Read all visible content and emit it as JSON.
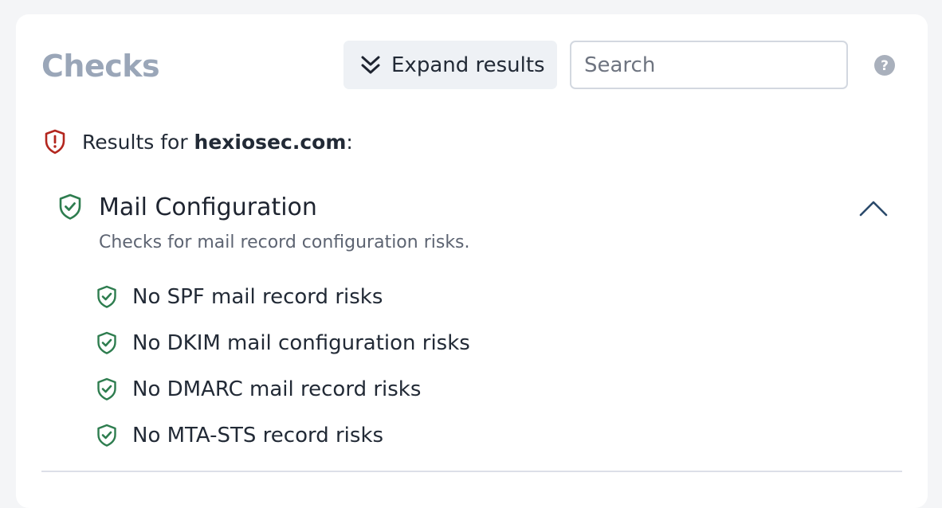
{
  "header": {
    "title": "Checks",
    "expand_label": "Expand results",
    "search_placeholder": "Search",
    "search_value": ""
  },
  "results": {
    "prefix": "Results for ",
    "domain": "hexiosec.com",
    "suffix": ":"
  },
  "section": {
    "title": "Mail Configuration",
    "description": "Checks for mail record configuration risks.",
    "expanded": true,
    "checks": [
      {
        "label": "No SPF mail record risks"
      },
      {
        "label": "No DKIM mail configuration risks"
      },
      {
        "label": "No DMARC mail record risks"
      },
      {
        "label": "No MTA-STS record risks"
      }
    ]
  },
  "colors": {
    "warning": "#b3261e",
    "success": "#2e7d4f",
    "title_muted": "#9aa6b8",
    "help_icon": "#a9b0bc",
    "chevron": "#2b4a6b"
  },
  "icons": {
    "expand": "double-chevron-down-icon",
    "help": "question-circle-icon",
    "results_status": "shield-exclamation-icon",
    "section_status": "shield-check-icon",
    "collapse": "chevron-up-icon"
  }
}
